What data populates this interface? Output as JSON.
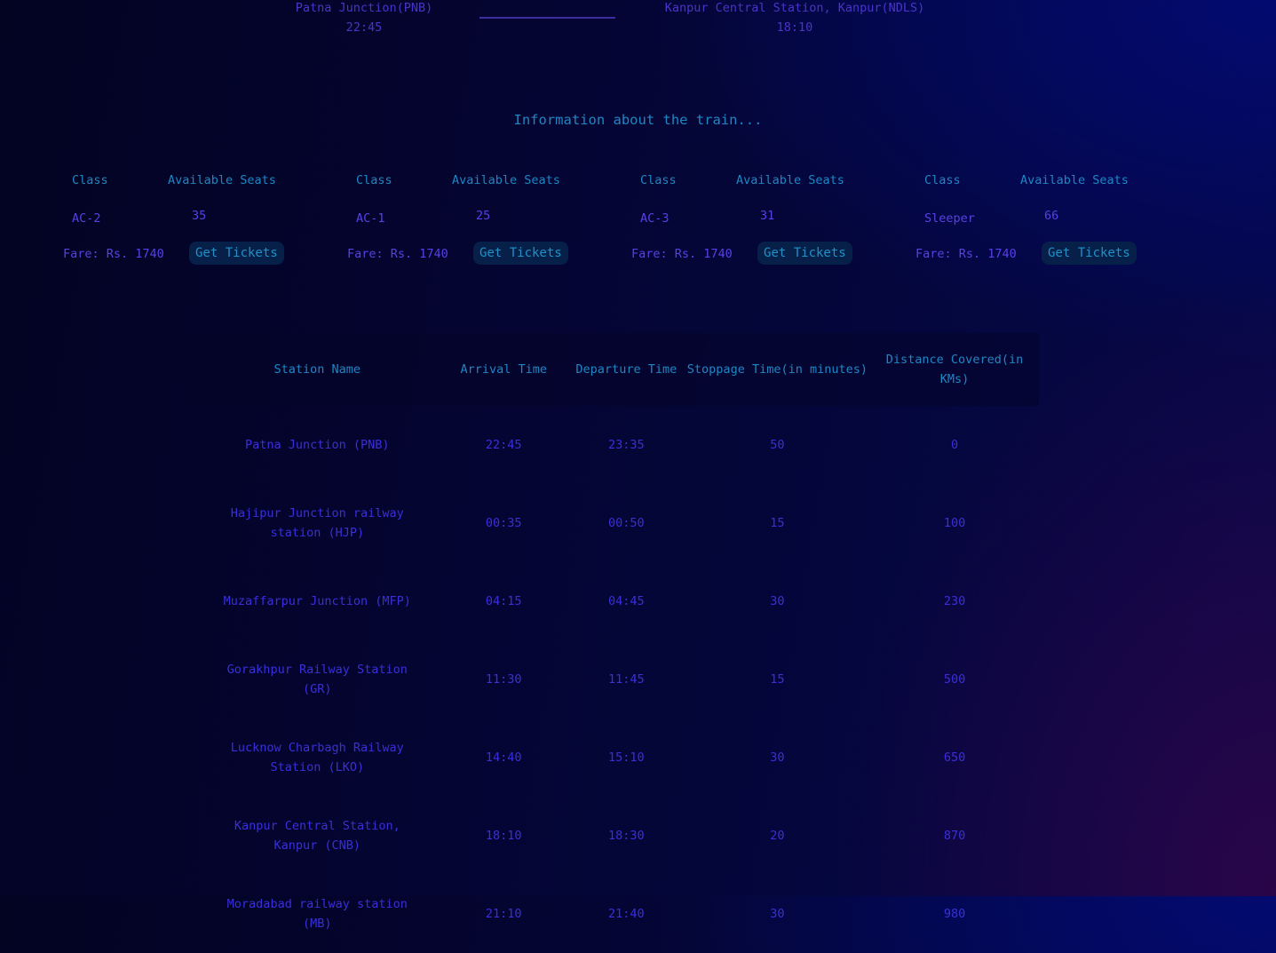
{
  "route": {
    "from_station": "Patna Junction(PNB)",
    "from_time": "22:45",
    "to_station": "Kanpur Central Station, Kanpur(NDLS)",
    "to_time": "18:10"
  },
  "info_title": "Information about the train...",
  "classes": [
    {
      "class_label": "Class",
      "seats_label": "Available Seats",
      "class": "AC-2",
      "seats": "35",
      "fare": "Fare: Rs. 1740",
      "button": "Get Tickets"
    },
    {
      "class_label": "Class",
      "seats_label": "Available Seats",
      "class": "AC-1",
      "seats": "25",
      "fare": "Fare: Rs. 1740",
      "button": "Get Tickets"
    },
    {
      "class_label": "Class",
      "seats_label": "Available Seats",
      "class": "AC-3",
      "seats": "31",
      "fare": "Fare: Rs. 1740",
      "button": "Get Tickets"
    },
    {
      "class_label": "Class",
      "seats_label": "Available Seats",
      "class": "Sleeper",
      "seats": "66",
      "fare": "Fare: Rs. 1740",
      "button": "Get Tickets"
    }
  ],
  "table": {
    "headers": [
      "Station Name",
      "Arrival Time",
      "Departure Time",
      "Stoppage Time(in minutes)",
      "Distance Covered(in KMs)"
    ],
    "rows": [
      [
        "Patna Junction (PNB)",
        "22:45",
        "23:35",
        "50",
        "0"
      ],
      [
        "Hajipur Junction railway station (HJP)",
        "00:35",
        "00:50",
        "15",
        "100"
      ],
      [
        "Muzaffarpur Junction (MFP)",
        "04:15",
        "04:45",
        "30",
        "230"
      ],
      [
        "Gorakhpur Railway Station (GR)",
        "11:30",
        "11:45",
        "15",
        "500"
      ],
      [
        "Lucknow Charbagh Railway Station (LKO)",
        "14:40",
        "15:10",
        "30",
        "650"
      ],
      [
        "Kanpur Central Station, Kanpur (CNB)",
        "18:10",
        "18:30",
        "20",
        "870"
      ],
      [
        "Moradabad railway station (MB)",
        "21:10",
        "21:40",
        "30",
        "980"
      ]
    ]
  }
}
